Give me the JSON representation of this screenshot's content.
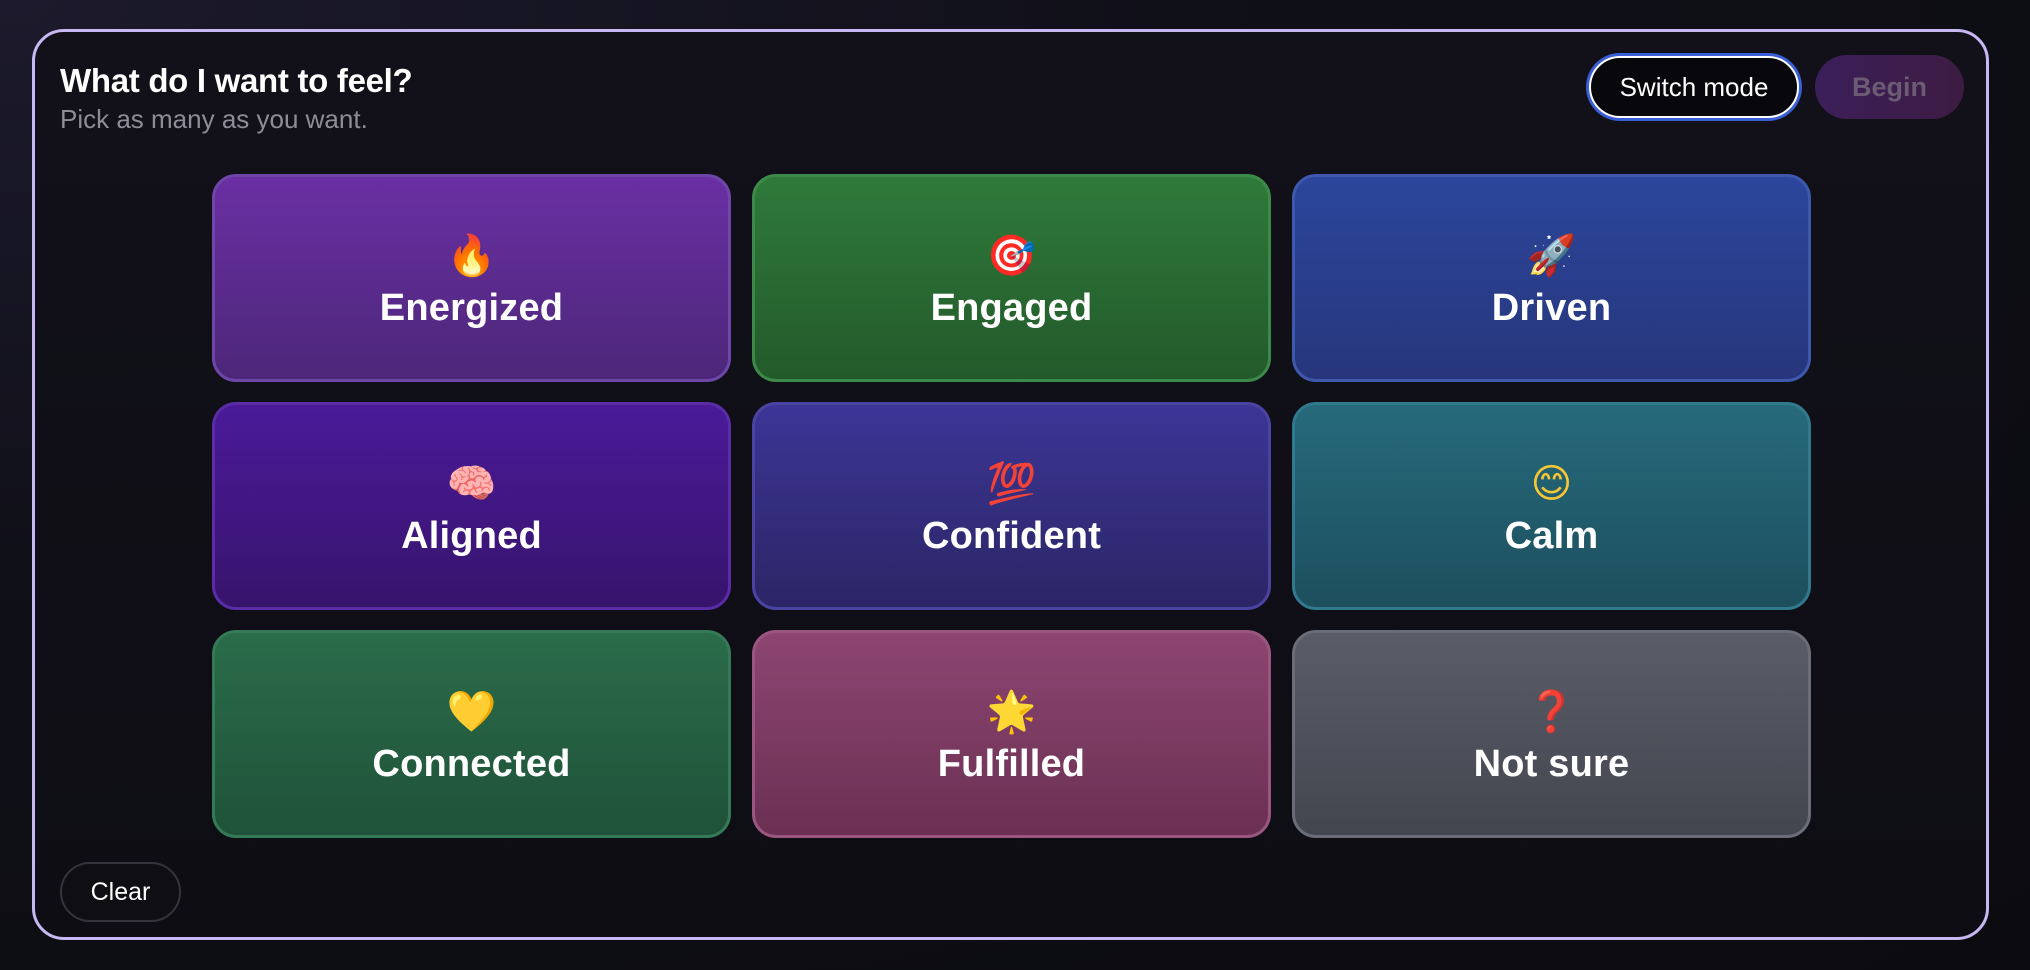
{
  "header": {
    "title": "What do I want to feel?",
    "subtitle": "Pick as many as you want."
  },
  "actions": {
    "switch_label": "Switch mode",
    "begin_label": "Begin",
    "clear_label": "Clear"
  },
  "feelings": [
    {
      "label": "Energized",
      "emoji": "🔥",
      "icon": "fire-icon",
      "colors": [
        "#6a2fa3",
        "#4c2779"
      ],
      "border": "#6e46a8",
      "emoji_color": "#ff7a1a"
    },
    {
      "label": "Engaged",
      "emoji": "🎯",
      "icon": "target-icon",
      "colors": [
        "#2f7a3a",
        "#235a2b"
      ],
      "border": "#3c8a49",
      "emoji_color": "#e23b3b"
    },
    {
      "label": "Driven",
      "emoji": "🚀",
      "icon": "rocket-icon",
      "colors": [
        "#2b469b",
        "#27367c"
      ],
      "border": "#3d58ad",
      "emoji_color": "#d8dbe6"
    },
    {
      "label": "Aligned",
      "emoji": "🧠",
      "icon": "brain-icon",
      "colors": [
        "#4a1a99",
        "#37146c"
      ],
      "border": "#5a2ca6",
      "emoji_color": "#f19bb2"
    },
    {
      "label": "Confident",
      "emoji": "💯",
      "icon": "hundred-points-icon",
      "colors": [
        "#3c3596",
        "#2b2666"
      ],
      "border": "#4a43a2",
      "emoji_color": "#e0333a"
    },
    {
      "label": "Calm",
      "emoji": "😊",
      "icon": "smiling-face-icon",
      "colors": [
        "#266a7c",
        "#1d4f5d"
      ],
      "border": "#31798c",
      "emoji_color": "#f7c634"
    },
    {
      "label": "Connected",
      "emoji": "💛",
      "icon": "yellow-heart-icon",
      "colors": [
        "#2a6c4a",
        "#1f5239"
      ],
      "border": "#357a57",
      "emoji_color": "#f5c518"
    },
    {
      "label": "Fulfilled",
      "emoji": "🌟",
      "icon": "glowing-star-icon",
      "colors": [
        "#8c4671",
        "#6b3053"
      ],
      "border": "#9a5680",
      "emoji_color": "#f7c634"
    },
    {
      "label": "Not sure",
      "emoji": "❓",
      "icon": "question-mark-icon",
      "colors": [
        "#5a5c68",
        "#43454f"
      ],
      "border": "#6a6c77",
      "emoji_color": "#e02a2a"
    }
  ]
}
